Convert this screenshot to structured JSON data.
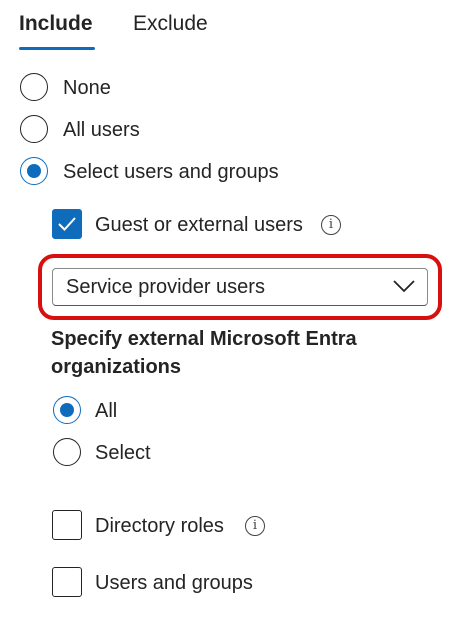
{
  "tabs": [
    {
      "label": "Include",
      "active": true
    },
    {
      "label": "Exclude",
      "active": false
    }
  ],
  "user_options": [
    {
      "label": "None",
      "selected": false
    },
    {
      "label": "All users",
      "selected": false
    },
    {
      "label": "Select users and groups",
      "selected": true
    }
  ],
  "guest_option": {
    "label": "Guest or external users",
    "checked": true,
    "info_icon": "info-icon"
  },
  "dropdown": {
    "selected_value": "Service provider users",
    "icon": "chevron-down-icon"
  },
  "external_orgs": {
    "heading": "Specify external Microsoft Entra organizations",
    "options": [
      {
        "label": "All",
        "selected": true
      },
      {
        "label": "Select",
        "selected": false
      }
    ]
  },
  "other_options": [
    {
      "label": "Directory roles",
      "checked": false,
      "info_icon": "info-icon"
    },
    {
      "label": "Users and groups",
      "checked": false
    }
  ],
  "colors": {
    "accent": "#0f6cbd",
    "highlight": "#d80f0f",
    "dropdown_border": "#6b3fa0"
  }
}
